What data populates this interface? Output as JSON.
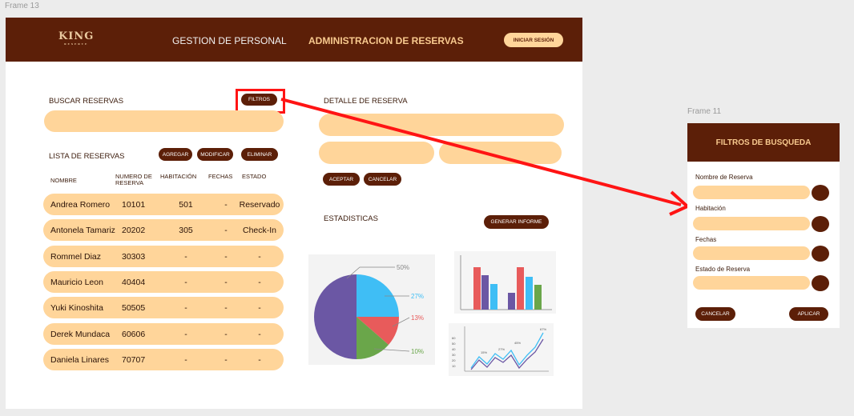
{
  "frames": {
    "main_label": "Frame 13",
    "side_label": "Frame 11"
  },
  "header": {
    "brand": "KING",
    "brand_sub": "RESERVE",
    "nav": [
      "GESTION DE PERSONAL",
      "ADMINISTRACION DE RESERVAS"
    ],
    "login": "INICIAR SESIÓN"
  },
  "search": {
    "title": "BUSCAR RESERVAS",
    "filters_button": "FILTROS"
  },
  "list": {
    "title": "LISTA DE RESERVAS",
    "buttons": [
      "AGREGAR",
      "MODIFICAR",
      "ELIMINAR"
    ],
    "columns": [
      "NOMBRE",
      "NUMERO DE RESERVA",
      "HABITACIÓN",
      "FECHAS",
      "ESTADO"
    ],
    "rows": [
      {
        "nombre": "Andrea Romero",
        "numero": "10101",
        "habitacion": "501",
        "fechas": "-",
        "estado": "Reservado"
      },
      {
        "nombre": "Antonela Tamariz",
        "numero": "20202",
        "habitacion": "305",
        "fechas": "-",
        "estado": "Check-In"
      },
      {
        "nombre": "Rommel Diaz",
        "numero": "30303",
        "habitacion": "-",
        "fechas": "-",
        "estado": "-"
      },
      {
        "nombre": "Mauricio Leon",
        "numero": "40404",
        "habitacion": "-",
        "fechas": "-",
        "estado": "-"
      },
      {
        "nombre": "Yuki Kinoshita",
        "numero": "50505",
        "habitacion": "-",
        "fechas": "-",
        "estado": "-"
      },
      {
        "nombre": "Derek Mundaca",
        "numero": "60606",
        "habitacion": "-",
        "fechas": "-",
        "estado": "-"
      },
      {
        "nombre": "Daniela Linares",
        "numero": "70707",
        "habitacion": "-",
        "fechas": "-",
        "estado": "-"
      }
    ]
  },
  "detail": {
    "title": "DETALLE DE RESERVA",
    "accept": "ACEPTAR",
    "cancel": "CANCELAR"
  },
  "stats": {
    "title": "ESTADISTICAS",
    "report_button": "GENERAR INFORME",
    "pie_labels": [
      "50%",
      "27%",
      "13%",
      "10%"
    ],
    "line_labels": [
      "15%",
      "27%",
      "45%",
      "67%"
    ],
    "line_axis": [
      "60",
      "50",
      "40",
      "30",
      "20",
      "10"
    ]
  },
  "filters_panel": {
    "title": "FILTROS DE BUSQUEDA",
    "fields": [
      "Nombre de Reserva",
      "Habitación",
      "Fechas",
      "Estado de Reserva"
    ],
    "cancel": "CANCELAR",
    "apply": "APLICAR"
  },
  "colors": {
    "brown": "#5c1f08",
    "peach": "#ffd59a",
    "highlight": "#ff1414"
  }
}
